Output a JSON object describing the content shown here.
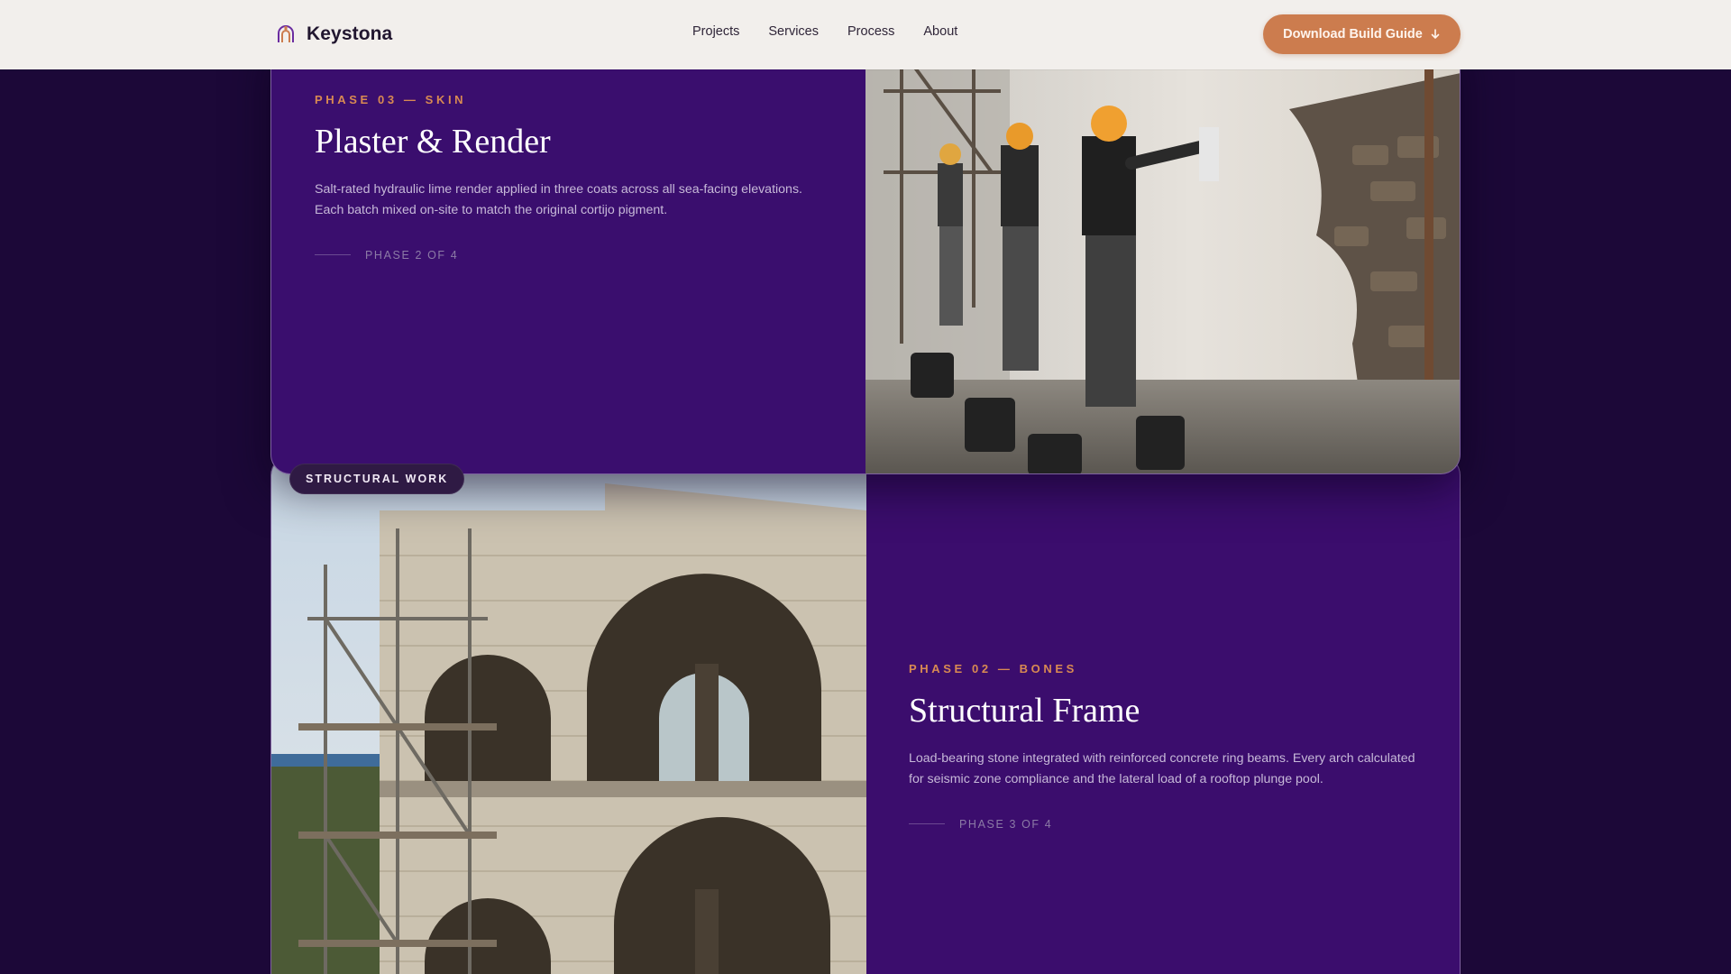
{
  "header": {
    "brand_name": "Keystona",
    "nav": [
      "Projects",
      "Services",
      "Process",
      "About"
    ],
    "cta_label": "Download Build Guide",
    "cta_icon": "arrow-down-icon"
  },
  "sections": [
    {
      "eyebrow": "PHASE 03 — SKIN",
      "title": "Plaster & Render",
      "description": "Salt-rated hydraulic lime render applied in three coats across all sea-facing elevations. Each batch mixed on-site to match the original cortijo pigment.",
      "phase_label": "PHASE 2 OF 4"
    },
    {
      "badge": "STRUCTURAL WORK",
      "eyebrow": "PHASE 02 — BONES",
      "title": "Structural Frame",
      "description": "Load-bearing stone integrated with reinforced concrete ring beams. Every arch calculated for seismic zone compliance and the lateral load of a rooftop plunge pool.",
      "phase_label": "PHASE 3 OF 4"
    }
  ],
  "colors": {
    "accent": "#cc7c4e",
    "eyebrow": "#d98a52",
    "card_bg": "#3a0e6e",
    "page_bg": "#1c0838",
    "header_bg": "#f2efec"
  }
}
